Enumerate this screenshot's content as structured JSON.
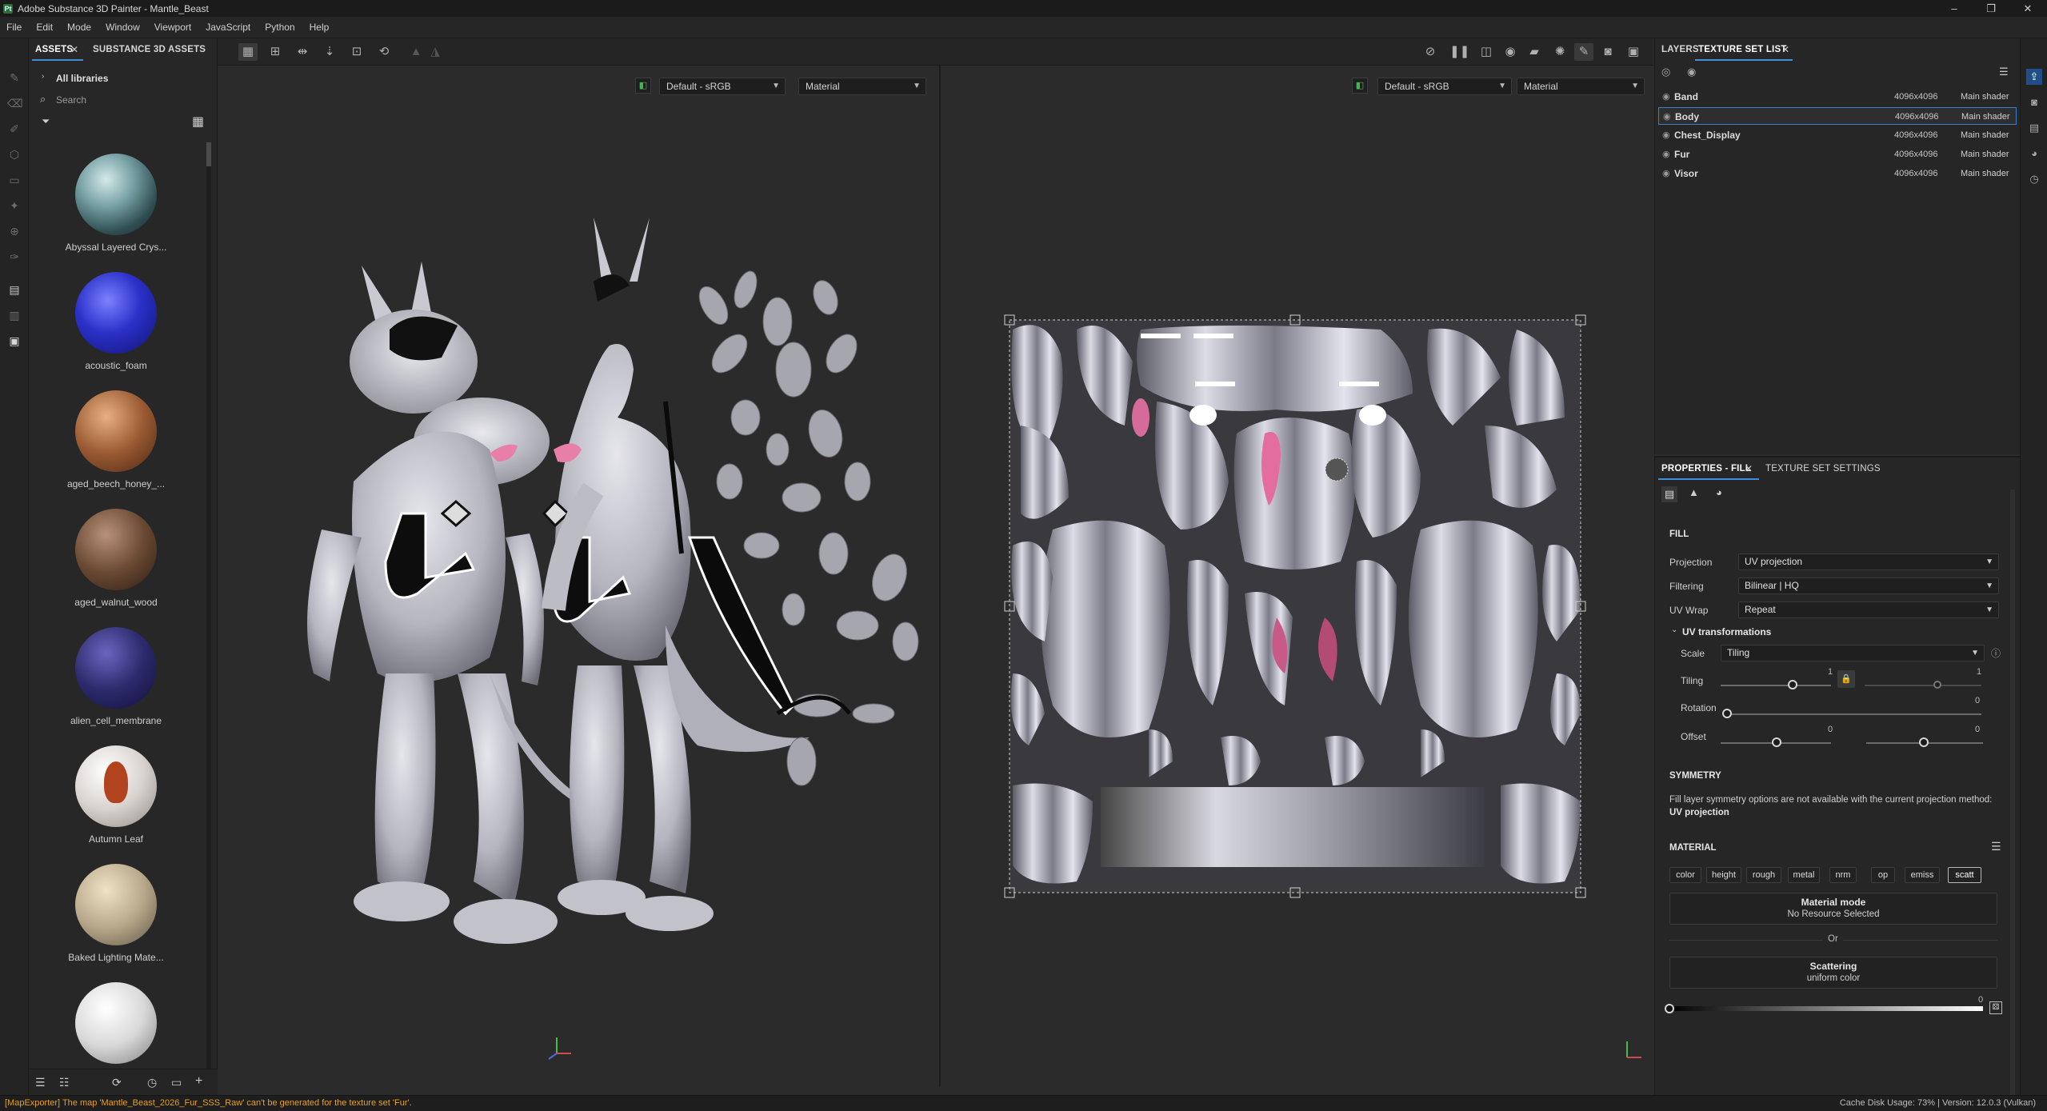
{
  "window": {
    "title": "Adobe Substance 3D Painter - Mantle_Beast",
    "app_icon": "Pt",
    "controls": [
      "–",
      "❐",
      "✕"
    ]
  },
  "menu": [
    "File",
    "Edit",
    "Mode",
    "Window",
    "Viewport",
    "JavaScript",
    "Python",
    "Help"
  ],
  "assets_panel": {
    "tabs": [
      "ASSETS",
      "SUBSTANCE 3D ASSETS"
    ],
    "all_libraries": "All libraries",
    "search_placeholder": "Search",
    "items": [
      {
        "label": "Abyssal Layered Crys...",
        "color": "#5c7f84"
      },
      {
        "label": "acoustic_foam",
        "color": "#2b31c9"
      },
      {
        "label": "aged_beech_honey_...",
        "color": "#9a5a33"
      },
      {
        "label": "aged_walnut_wood",
        "color": "#6b4a34"
      },
      {
        "label": "alien_cell_membrane",
        "color": "#2c2a6b"
      },
      {
        "label": "Autumn Leaf",
        "color": "#d8d3cf"
      },
      {
        "label": "Baked Lighting Mate...",
        "color": "#b9a98c"
      },
      {
        "label": "",
        "color": "#d9d9d9"
      }
    ]
  },
  "viewport_3d": {
    "colorspace": "Default - sRGB",
    "channel": "Material"
  },
  "viewport_2d": {
    "colorspace": "Default - sRGB",
    "channel": "Material"
  },
  "layers_panel": {
    "tabs": [
      "LAYERS",
      "TEXTURE SET LIST"
    ],
    "rows": [
      {
        "name": "Band",
        "size": "4096x4096",
        "shader": "Main shader",
        "selected": false
      },
      {
        "name": "Body",
        "size": "4096x4096",
        "shader": "Main shader",
        "selected": true
      },
      {
        "name": "Chest_Display",
        "size": "4096x4096",
        "shader": "Main shader",
        "selected": false
      },
      {
        "name": "Fur",
        "size": "4096x4096",
        "shader": "Main shader",
        "selected": false
      },
      {
        "name": "Visor",
        "size": "4096x4096",
        "shader": "Main shader",
        "selected": false
      }
    ]
  },
  "properties": {
    "tabs": [
      "PROPERTIES - FILL",
      "TEXTURE SET SETTINGS"
    ],
    "fill_title": "FILL",
    "projection_label": "Projection",
    "projection": "UV projection",
    "filtering_label": "Filtering",
    "filtering": "Bilinear | HQ",
    "uvwrap_label": "UV Wrap",
    "uvwrap": "Repeat",
    "uv_transform_title": "UV transformations",
    "scale_label": "Scale",
    "scale": "Tiling",
    "tiling_label": "Tiling",
    "tiling_value": "1",
    "tiling_value2": "1",
    "rotation_label": "Rotation",
    "rotation_value": "0",
    "offset_label": "Offset",
    "offset_value": "0",
    "offset_value2": "0",
    "symmetry_title": "SYMMETRY",
    "symmetry_text": "Fill layer symmetry options are not available with the current projection method:",
    "symmetry_method": "UV projection",
    "material_title": "MATERIAL",
    "channels": [
      "color",
      "height",
      "rough",
      "metal",
      "nrm",
      "op",
      "emiss",
      "scatt"
    ],
    "material_mode_title": "Material mode",
    "material_mode_sub": "No Resource Selected",
    "or_label": "Or",
    "scattering_title": "Scattering",
    "scattering_sub": "uniform color",
    "scatter_value": "0"
  },
  "status": {
    "message": "[MapExporter] The map 'Mantle_Beast_2026_Fur_SSS_Raw' can't be generated for the texture set 'Fur'.",
    "right": "Cache Disk Usage:    73% | Version: 12.0.3 (Vulkan)"
  }
}
